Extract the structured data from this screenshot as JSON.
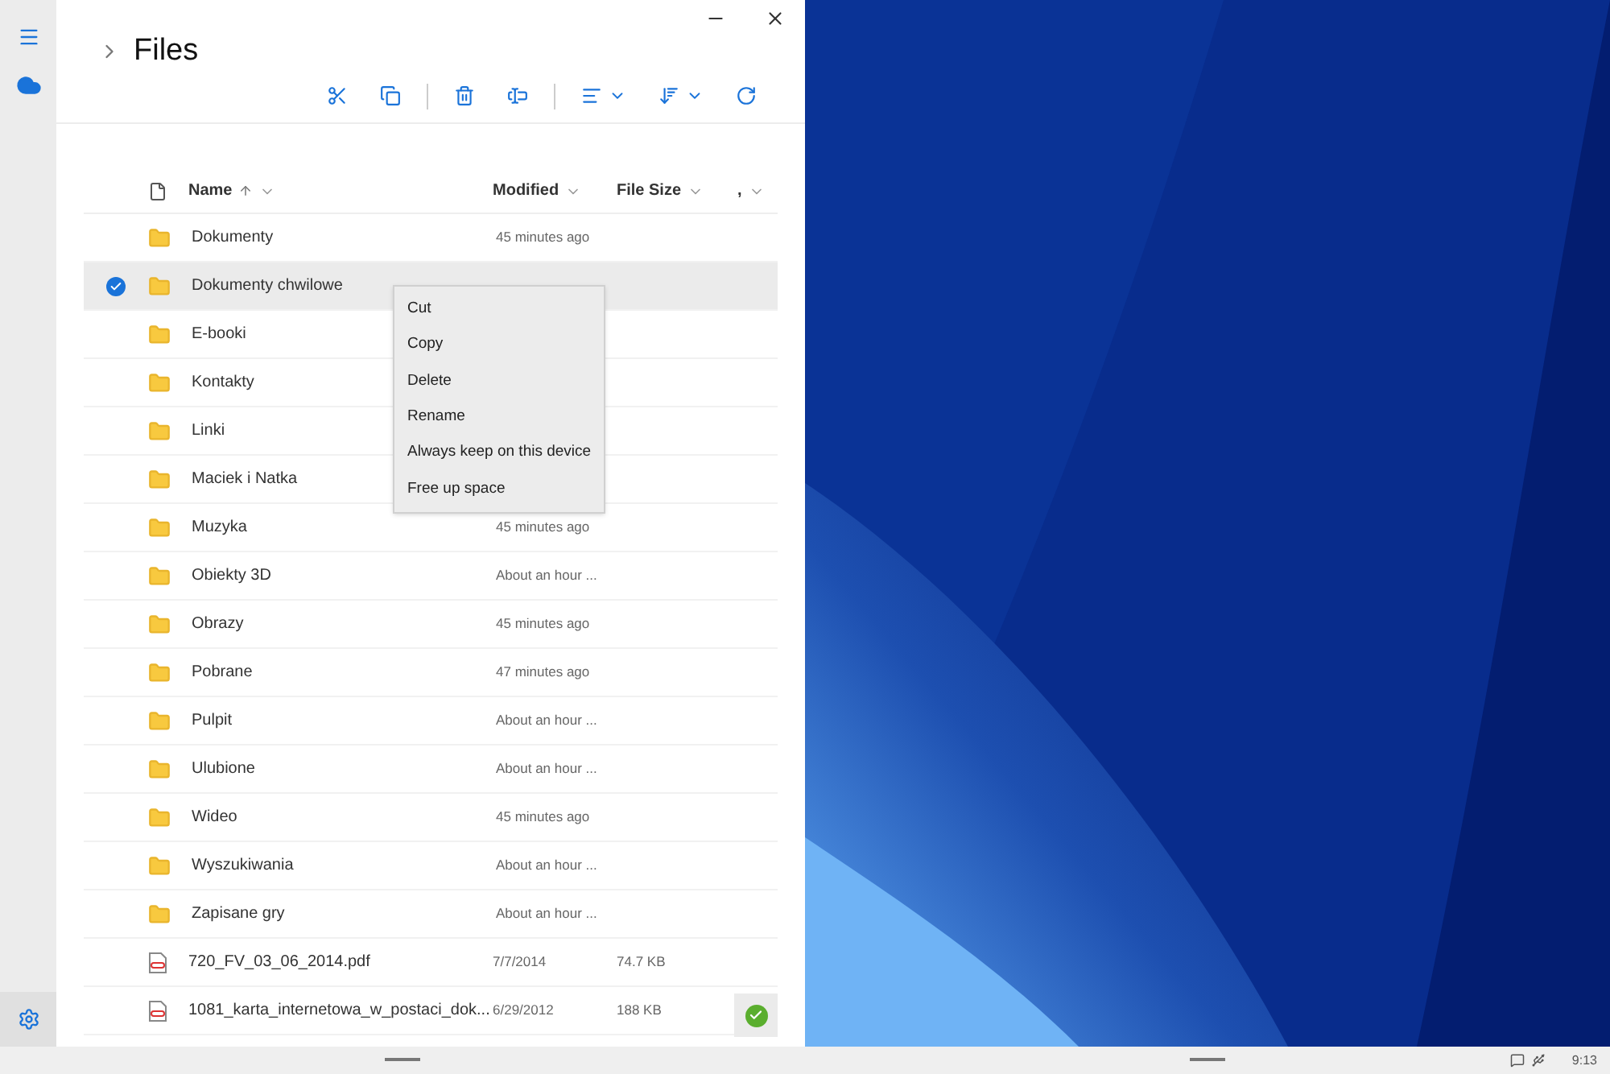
{
  "title": "Files",
  "columns": [
    {
      "label": "Name",
      "sorted": true
    },
    {
      "label": "Modified",
      "sorted": false
    },
    {
      "label": "File Size",
      "sorted": false
    },
    {
      "label": ",",
      "sorted": false
    }
  ],
  "rows": [
    {
      "kind": "folder",
      "name": "Dokumenty",
      "modified": "45 minutes ago",
      "selected": false
    },
    {
      "kind": "folder",
      "name": "Dokumenty chwilowe",
      "selected": true
    },
    {
      "kind": "folder",
      "name": "E-booki",
      "selected": false
    },
    {
      "kind": "folder",
      "name": "Kontakty",
      "selected": false
    },
    {
      "kind": "folder",
      "name": "Linki",
      "selected": false
    },
    {
      "kind": "folder",
      "name": "Maciek i Natka",
      "selected": false
    },
    {
      "kind": "folder",
      "name": "Muzyka",
      "modified": "45 minutes ago",
      "selected": false
    },
    {
      "kind": "folder",
      "name": "Obiekty 3D",
      "modified": "About an hour ...",
      "selected": false
    },
    {
      "kind": "folder",
      "name": "Obrazy",
      "modified": "45 minutes ago",
      "selected": false
    },
    {
      "kind": "folder",
      "name": "Pobrane",
      "modified": "47 minutes ago",
      "selected": false
    },
    {
      "kind": "folder",
      "name": "Pulpit",
      "modified": "About an hour ...",
      "selected": false
    },
    {
      "kind": "folder",
      "name": "Ulubione",
      "modified": "About an hour ...",
      "selected": false
    },
    {
      "kind": "folder",
      "name": "Wideo",
      "modified": "45 minutes ago",
      "selected": false
    },
    {
      "kind": "folder",
      "name": "Wyszukiwania",
      "modified": "About an hour ...",
      "selected": false
    },
    {
      "kind": "folder",
      "name": "Zapisane gry",
      "modified": "About an hour ...",
      "selected": false
    },
    {
      "kind": "pdf",
      "name": "720_FV_03_06_2014.pdf",
      "modified": "7/7/2014",
      "size": "74.7 KB",
      "selected": false
    },
    {
      "kind": "pdf",
      "name": "1081_karta_internetowa_w_postaci_dok...",
      "modified": "6/29/2012",
      "size": "188 KB",
      "selected": false
    }
  ],
  "context_menu": [
    "Cut",
    "Copy",
    "Delete",
    "Rename",
    "Always keep on this device",
    "Free up space"
  ],
  "taskbar": {
    "clock": "9:13"
  }
}
